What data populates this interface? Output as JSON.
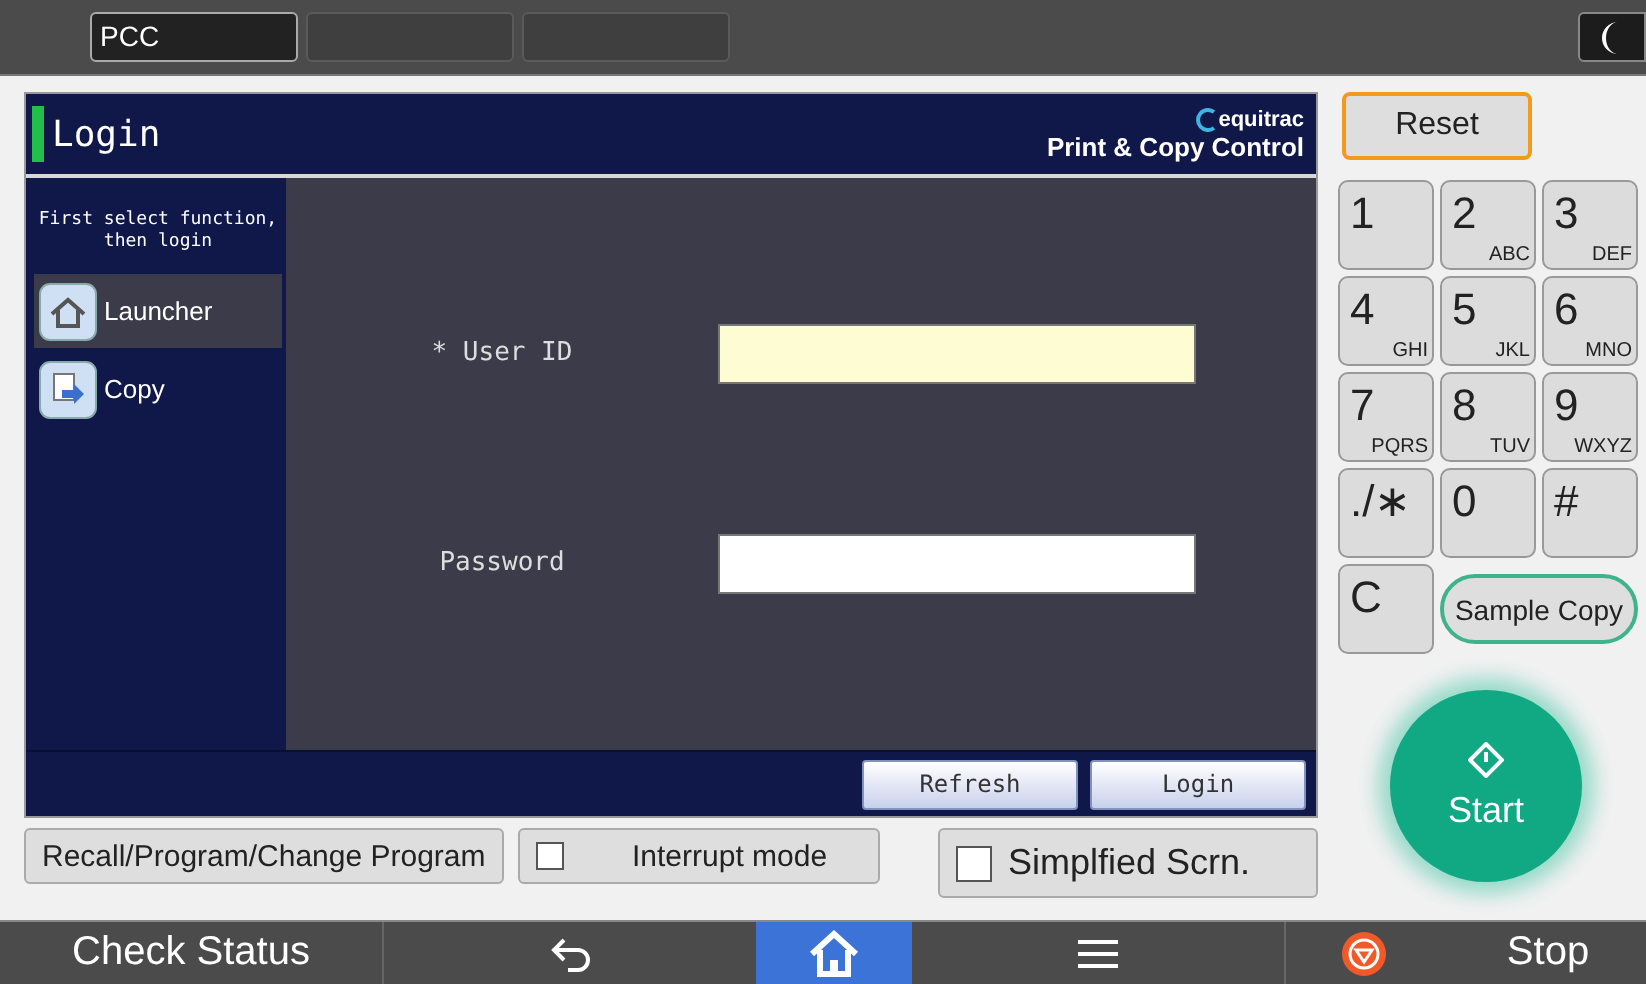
{
  "top_bar": {
    "tabs": [
      {
        "label": "PCC",
        "selected": true
      },
      {
        "selected": false
      },
      {
        "selected": false
      }
    ]
  },
  "panel": {
    "title": "Login",
    "brand": "equitrac",
    "product": "Print & Copy Control",
    "sidebar": {
      "hint": "First select function, then login",
      "items": [
        {
          "label": "Launcher",
          "kind": "home",
          "selected": true
        },
        {
          "label": "Copy",
          "kind": "copy",
          "selected": false
        }
      ]
    },
    "fields": [
      {
        "label": "* User ID",
        "focused": true
      },
      {
        "label": "Password",
        "focused": false
      }
    ],
    "buttons": [
      "Refresh",
      "Login"
    ]
  },
  "actions": {
    "program_button": "Recall/Program/Change Program",
    "interrupt": {
      "label": "Interrupt mode",
      "checked": false
    },
    "simplified": {
      "label": "Simplfied Scrn.",
      "checked": false
    }
  },
  "keypad": {
    "reset": "Reset",
    "keys": [
      {
        "main": "1"
      },
      {
        "main": "2",
        "sub": "ABC"
      },
      {
        "main": "3",
        "sub": "DEF"
      },
      {
        "main": "4",
        "sub": "GHI"
      },
      {
        "main": "5",
        "sub": "JKL"
      },
      {
        "main": "6",
        "sub": "MNO"
      },
      {
        "main": "7",
        "sub": "PQRS"
      },
      {
        "main": "8",
        "sub": "TUV"
      },
      {
        "main": "9",
        "sub": "WXYZ"
      },
      {
        "main": "./∗"
      },
      {
        "main": "0"
      },
      {
        "main": "#"
      },
      {
        "main": "C"
      }
    ],
    "sample_copy": "Sample Copy",
    "start": "Start"
  },
  "bottom_bar": [
    {
      "kind": "text",
      "label": "Check Status",
      "selected": false
    },
    {
      "kind": "back",
      "selected": false
    },
    {
      "kind": "home",
      "selected": true
    },
    {
      "kind": "menu",
      "selected": false
    },
    {
      "kind": "stop",
      "label": "Stop",
      "selected": false
    }
  ]
}
